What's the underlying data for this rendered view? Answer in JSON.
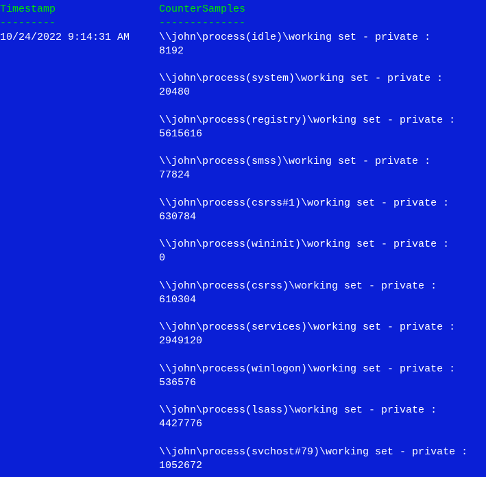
{
  "headers": {
    "timestamp": "Timestamp",
    "counterSamples": "CounterSamples",
    "tsDash": "---------",
    "csDash": "--------------"
  },
  "timestamp": "10/24/2022 9:14:31 AM",
  "samples": [
    {
      "path": "\\\\john\\process(idle)\\working set - private :",
      "value": "8192"
    },
    {
      "path": "\\\\john\\process(system)\\working set - private :",
      "value": "20480"
    },
    {
      "path": "\\\\john\\process(registry)\\working set - private :",
      "value": "5615616"
    },
    {
      "path": "\\\\john\\process(smss)\\working set - private :",
      "value": "77824"
    },
    {
      "path": "\\\\john\\process(csrss#1)\\working set - private :",
      "value": "630784"
    },
    {
      "path": "\\\\john\\process(wininit)\\working set - private :",
      "value": "0"
    },
    {
      "path": "\\\\john\\process(csrss)\\working set - private :",
      "value": "610304"
    },
    {
      "path": "\\\\john\\process(services)\\working set - private :",
      "value": "2949120"
    },
    {
      "path": "\\\\john\\process(winlogon)\\working set - private :",
      "value": "536576"
    },
    {
      "path": "\\\\john\\process(lsass)\\working set - private :",
      "value": "4427776"
    },
    {
      "path": "\\\\john\\process(svchost#79)\\working set - private :",
      "value": "1052672"
    }
  ]
}
